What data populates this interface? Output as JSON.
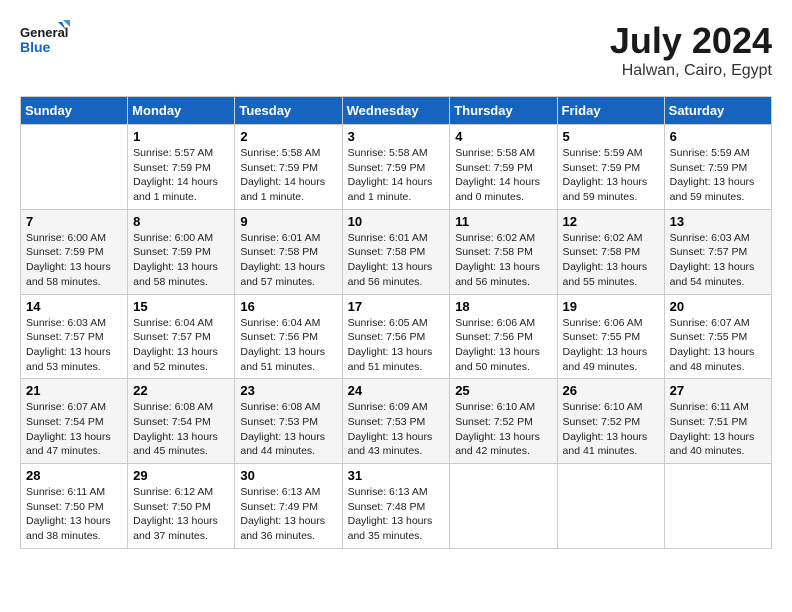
{
  "header": {
    "logo_line1": "General",
    "logo_line2": "Blue",
    "month_title": "July 2024",
    "location": "Halwan, Cairo, Egypt"
  },
  "weekdays": [
    "Sunday",
    "Monday",
    "Tuesday",
    "Wednesday",
    "Thursday",
    "Friday",
    "Saturday"
  ],
  "weeks": [
    [
      {
        "day": "",
        "sunrise": "",
        "sunset": "",
        "daylight": ""
      },
      {
        "day": "1",
        "sunrise": "Sunrise: 5:57 AM",
        "sunset": "Sunset: 7:59 PM",
        "daylight": "Daylight: 14 hours and 1 minute."
      },
      {
        "day": "2",
        "sunrise": "Sunrise: 5:58 AM",
        "sunset": "Sunset: 7:59 PM",
        "daylight": "Daylight: 14 hours and 1 minute."
      },
      {
        "day": "3",
        "sunrise": "Sunrise: 5:58 AM",
        "sunset": "Sunset: 7:59 PM",
        "daylight": "Daylight: 14 hours and 1 minute."
      },
      {
        "day": "4",
        "sunrise": "Sunrise: 5:58 AM",
        "sunset": "Sunset: 7:59 PM",
        "daylight": "Daylight: 14 hours and 0 minutes."
      },
      {
        "day": "5",
        "sunrise": "Sunrise: 5:59 AM",
        "sunset": "Sunset: 7:59 PM",
        "daylight": "Daylight: 13 hours and 59 minutes."
      },
      {
        "day": "6",
        "sunrise": "Sunrise: 5:59 AM",
        "sunset": "Sunset: 7:59 PM",
        "daylight": "Daylight: 13 hours and 59 minutes."
      }
    ],
    [
      {
        "day": "7",
        "sunrise": "Sunrise: 6:00 AM",
        "sunset": "Sunset: 7:59 PM",
        "daylight": "Daylight: 13 hours and 58 minutes."
      },
      {
        "day": "8",
        "sunrise": "Sunrise: 6:00 AM",
        "sunset": "Sunset: 7:59 PM",
        "daylight": "Daylight: 13 hours and 58 minutes."
      },
      {
        "day": "9",
        "sunrise": "Sunrise: 6:01 AM",
        "sunset": "Sunset: 7:58 PM",
        "daylight": "Daylight: 13 hours and 57 minutes."
      },
      {
        "day": "10",
        "sunrise": "Sunrise: 6:01 AM",
        "sunset": "Sunset: 7:58 PM",
        "daylight": "Daylight: 13 hours and 56 minutes."
      },
      {
        "day": "11",
        "sunrise": "Sunrise: 6:02 AM",
        "sunset": "Sunset: 7:58 PM",
        "daylight": "Daylight: 13 hours and 56 minutes."
      },
      {
        "day": "12",
        "sunrise": "Sunrise: 6:02 AM",
        "sunset": "Sunset: 7:58 PM",
        "daylight": "Daylight: 13 hours and 55 minutes."
      },
      {
        "day": "13",
        "sunrise": "Sunrise: 6:03 AM",
        "sunset": "Sunset: 7:57 PM",
        "daylight": "Daylight: 13 hours and 54 minutes."
      }
    ],
    [
      {
        "day": "14",
        "sunrise": "Sunrise: 6:03 AM",
        "sunset": "Sunset: 7:57 PM",
        "daylight": "Daylight: 13 hours and 53 minutes."
      },
      {
        "day": "15",
        "sunrise": "Sunrise: 6:04 AM",
        "sunset": "Sunset: 7:57 PM",
        "daylight": "Daylight: 13 hours and 52 minutes."
      },
      {
        "day": "16",
        "sunrise": "Sunrise: 6:04 AM",
        "sunset": "Sunset: 7:56 PM",
        "daylight": "Daylight: 13 hours and 51 minutes."
      },
      {
        "day": "17",
        "sunrise": "Sunrise: 6:05 AM",
        "sunset": "Sunset: 7:56 PM",
        "daylight": "Daylight: 13 hours and 51 minutes."
      },
      {
        "day": "18",
        "sunrise": "Sunrise: 6:06 AM",
        "sunset": "Sunset: 7:56 PM",
        "daylight": "Daylight: 13 hours and 50 minutes."
      },
      {
        "day": "19",
        "sunrise": "Sunrise: 6:06 AM",
        "sunset": "Sunset: 7:55 PM",
        "daylight": "Daylight: 13 hours and 49 minutes."
      },
      {
        "day": "20",
        "sunrise": "Sunrise: 6:07 AM",
        "sunset": "Sunset: 7:55 PM",
        "daylight": "Daylight: 13 hours and 48 minutes."
      }
    ],
    [
      {
        "day": "21",
        "sunrise": "Sunrise: 6:07 AM",
        "sunset": "Sunset: 7:54 PM",
        "daylight": "Daylight: 13 hours and 47 minutes."
      },
      {
        "day": "22",
        "sunrise": "Sunrise: 6:08 AM",
        "sunset": "Sunset: 7:54 PM",
        "daylight": "Daylight: 13 hours and 45 minutes."
      },
      {
        "day": "23",
        "sunrise": "Sunrise: 6:08 AM",
        "sunset": "Sunset: 7:53 PM",
        "daylight": "Daylight: 13 hours and 44 minutes."
      },
      {
        "day": "24",
        "sunrise": "Sunrise: 6:09 AM",
        "sunset": "Sunset: 7:53 PM",
        "daylight": "Daylight: 13 hours and 43 minutes."
      },
      {
        "day": "25",
        "sunrise": "Sunrise: 6:10 AM",
        "sunset": "Sunset: 7:52 PM",
        "daylight": "Daylight: 13 hours and 42 minutes."
      },
      {
        "day": "26",
        "sunrise": "Sunrise: 6:10 AM",
        "sunset": "Sunset: 7:52 PM",
        "daylight": "Daylight: 13 hours and 41 minutes."
      },
      {
        "day": "27",
        "sunrise": "Sunrise: 6:11 AM",
        "sunset": "Sunset: 7:51 PM",
        "daylight": "Daylight: 13 hours and 40 minutes."
      }
    ],
    [
      {
        "day": "28",
        "sunrise": "Sunrise: 6:11 AM",
        "sunset": "Sunset: 7:50 PM",
        "daylight": "Daylight: 13 hours and 38 minutes."
      },
      {
        "day": "29",
        "sunrise": "Sunrise: 6:12 AM",
        "sunset": "Sunset: 7:50 PM",
        "daylight": "Daylight: 13 hours and 37 minutes."
      },
      {
        "day": "30",
        "sunrise": "Sunrise: 6:13 AM",
        "sunset": "Sunset: 7:49 PM",
        "daylight": "Daylight: 13 hours and 36 minutes."
      },
      {
        "day": "31",
        "sunrise": "Sunrise: 6:13 AM",
        "sunset": "Sunset: 7:48 PM",
        "daylight": "Daylight: 13 hours and 35 minutes."
      },
      {
        "day": "",
        "sunrise": "",
        "sunset": "",
        "daylight": ""
      },
      {
        "day": "",
        "sunrise": "",
        "sunset": "",
        "daylight": ""
      },
      {
        "day": "",
        "sunrise": "",
        "sunset": "",
        "daylight": ""
      }
    ]
  ]
}
